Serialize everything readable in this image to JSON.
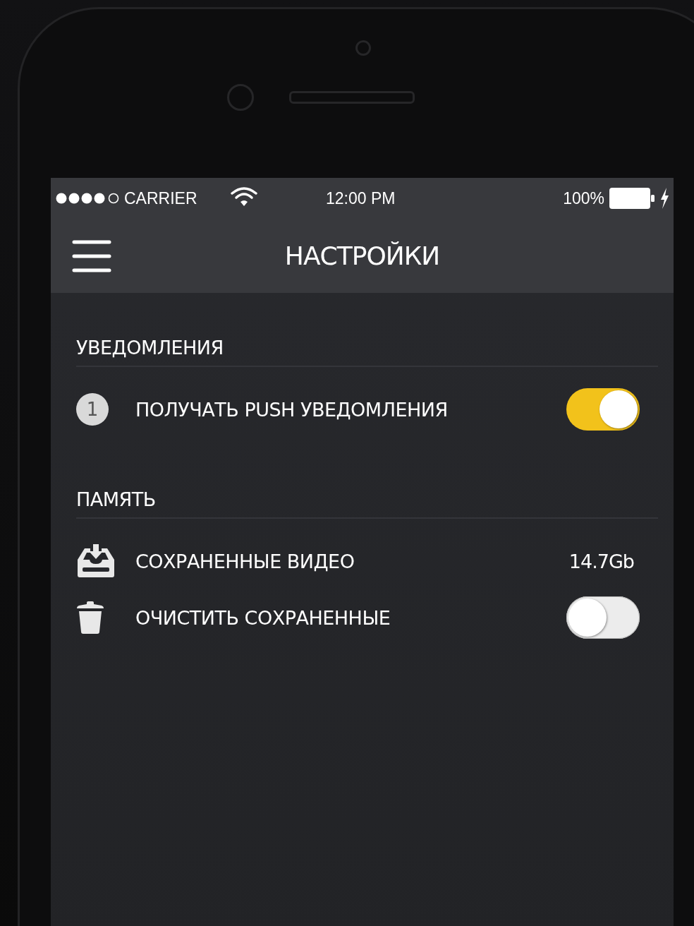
{
  "status_bar": {
    "carrier": "CARRIER",
    "time": "12:00 PM",
    "battery": "100%",
    "charging": true
  },
  "nav": {
    "title": "НАСТРОЙКИ"
  },
  "sections": [
    {
      "title": "УВЕДОМЛЕНИЯ",
      "rows": [
        {
          "kind": "toggle",
          "badge": "1",
          "label": "ПОЛУЧАТЬ PUSH УВЕДОМЛЕНИЯ",
          "on": true
        }
      ]
    },
    {
      "title": "ПАМЯТЬ",
      "rows": [
        {
          "kind": "value",
          "label": "СОХРАНЕННЫЕ ВИДЕО",
          "value": "14.7Gb"
        },
        {
          "kind": "toggle",
          "label": "ОЧИСТИТЬ СОХРАНЕННЫЕ",
          "on": false
        }
      ]
    }
  ]
}
